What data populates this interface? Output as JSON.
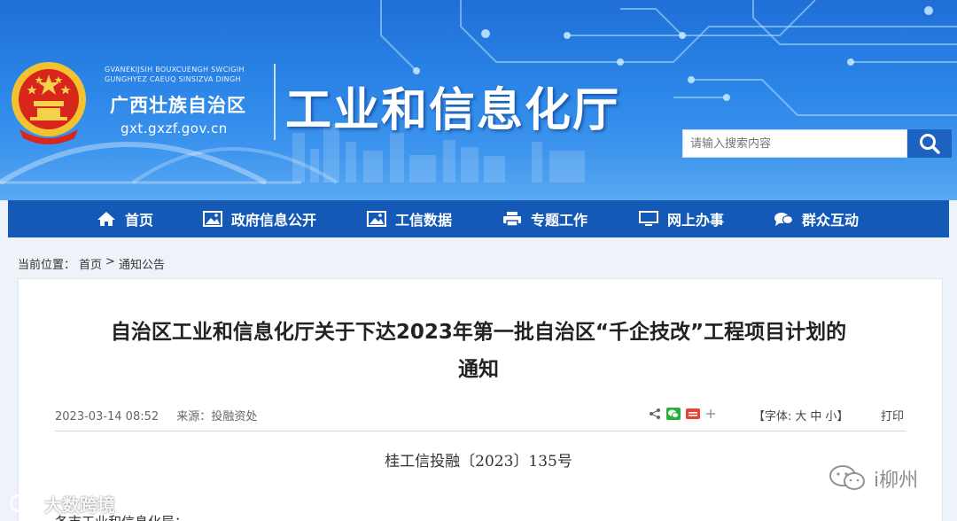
{
  "header": {
    "site_small_text_line1": "GVANEKIJSIH BOUXCUENGH SWCIGIH",
    "site_small_text_line2": "GUNGHYEZ CAEUQ SINSIZVA DINGH",
    "region_name": "广西壮族自治区",
    "domain": "gxt.gxzf.gov.cn",
    "department_title": "工业和信息化厅",
    "search_placeholder": "请输入搜索内容",
    "search_icon": "search-icon",
    "emblem_icon": "national-emblem"
  },
  "nav": {
    "items": [
      {
        "label": "首页",
        "icon": "home-icon"
      },
      {
        "label": "政府信息公开",
        "icon": "image-icon"
      },
      {
        "label": "工信数据",
        "icon": "image-icon"
      },
      {
        "label": "专题工作",
        "icon": "printer-icon"
      },
      {
        "label": "网上办事",
        "icon": "monitor-icon"
      },
      {
        "label": "群众互动",
        "icon": "chat-icon"
      }
    ]
  },
  "breadcrumb": {
    "prefix": "当前位置：",
    "home": "首页",
    "separator": ">",
    "current": "通知公告"
  },
  "article": {
    "title_line1": "自治区工业和信息化厅关于下达2023年第一批自治区“千企技改”工程项目计划的",
    "title_line2": "通知",
    "date": "2023-03-14 08:52",
    "source_label": "来源：",
    "source": "投融资处",
    "font_size_label": "【字体:",
    "font_large": "大",
    "font_medium": "中",
    "font_small": "小",
    "font_size_end": "】",
    "print": "打印",
    "doc_number": "桂工信投融〔2023〕135号",
    "greeting_partial": "各市工业和信息化局："
  },
  "watermarks": {
    "left": "大数跨境",
    "right": "i柳州"
  },
  "colors": {
    "header_blue": "#2c86e8",
    "nav_blue": "#1559b7",
    "search_button": "#1d62c0",
    "page_bg": "#eef3f9"
  }
}
